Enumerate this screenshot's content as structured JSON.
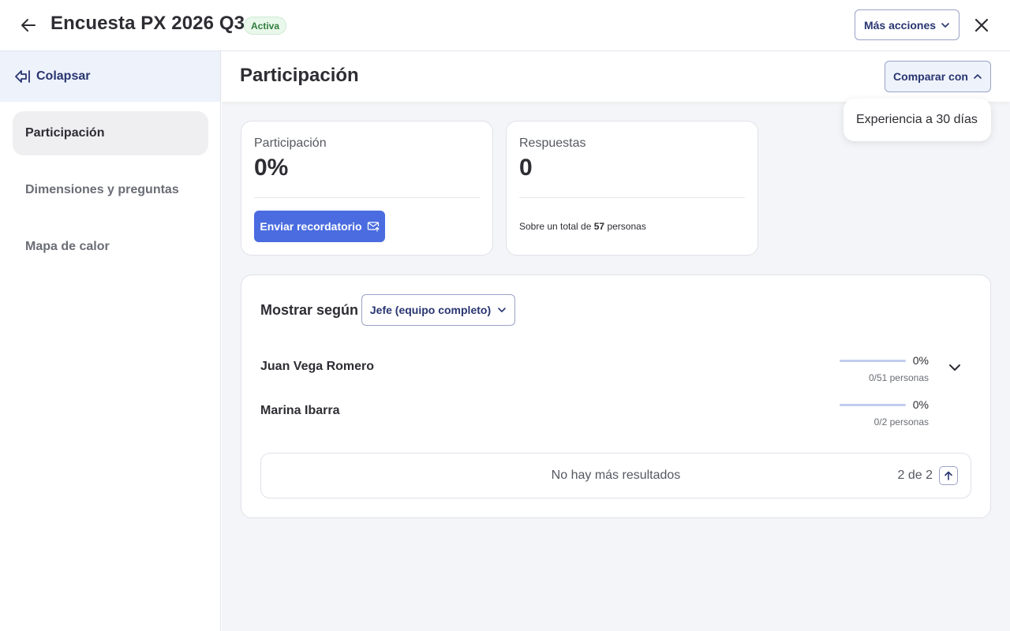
{
  "header": {
    "title": "Encuesta PX 2026 Q3",
    "status": "Activa",
    "more_actions": "Más acciones"
  },
  "sidebar": {
    "collapse_label": "Colapsar",
    "items": [
      {
        "label": "Participación",
        "active": true
      },
      {
        "label": "Dimensiones y preguntas",
        "active": false
      },
      {
        "label": "Mapa de calor",
        "active": false
      }
    ]
  },
  "section": {
    "title": "Participación",
    "compare_label": "Comparar con",
    "compare_option": "Experiencia a 30 días"
  },
  "participation_card": {
    "label": "Participación",
    "value": "0%",
    "reminder_button": "Enviar recordatorio"
  },
  "responses_card": {
    "label": "Respuestas",
    "value": "0",
    "total_prefix": "Sobre un total de",
    "total_count": "57",
    "total_suffix": "personas"
  },
  "breakdown": {
    "show_label": "Mostrar según",
    "group_select": "Jefe (equipo completo)",
    "rows": [
      {
        "name": "Juan Vega Romero",
        "percent": "0%",
        "people": "0/51 personas",
        "progress": 0,
        "expandable": true
      },
      {
        "name": "Marina Ibarra",
        "percent": "0%",
        "people": "0/2 personas",
        "progress": 0,
        "expandable": false
      }
    ],
    "no_more": "No hay más resultados",
    "page_count": "2 de 2"
  },
  "colors": {
    "accent": "#4a6ce0",
    "navy": "#283570",
    "badge_green": "#2e7d3b"
  }
}
